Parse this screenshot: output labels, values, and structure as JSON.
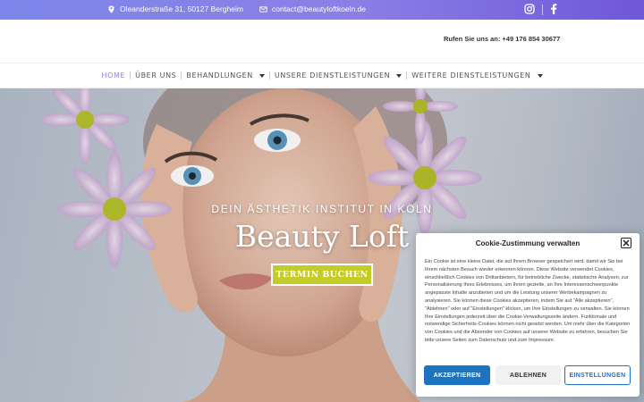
{
  "topbar": {
    "address": "Oleanderstraße 31, 50127 Bergheim",
    "email": "contact@beautyloftkoeln.de",
    "icons": [
      "map-pin-icon",
      "mail-icon",
      "instagram-icon",
      "facebook-icon"
    ]
  },
  "header": {
    "phone": "Rufen Sie uns an: +49 176 854 30677"
  },
  "nav": {
    "items": [
      {
        "label": "HOME",
        "active": true
      },
      {
        "label": "ÜBER UNS"
      },
      {
        "label": "BEHANDLUNGEN",
        "dropdown": true
      },
      {
        "label": "UNSERE DIENSTLEISTUNGEN",
        "dropdown": true
      },
      {
        "label": "WEITERE DIENSTLEISTUNGEN",
        "dropdown": true
      }
    ]
  },
  "hero": {
    "tagline": "DEIN ÄSTHETIK INSTITUT IN KÖLN",
    "title": "Beauty Loft",
    "cta": "TERMIN BUCHEN"
  },
  "cookie": {
    "title": "Cookie-Zustimmung verwalten",
    "body": "Ein Cookie ist eine kleine Datei, die auf Ihrem Browser gespeichert wird, damit wir Sie bei Ihrem nächsten Besuch wieder erkennen können. Diese Website verwendet Cookies, einschließlich Cookies von Drittanbietern, für betriebliche Zwecke, statistische Analysen, zur Personalisierung Ihres Erlebnisses, um Ihnen gezielte, an Ihre Interessenschwerpunkte angepasste Inhalte anzubieten und um die Leistung unserer Werbekampagnen zu analysieren. Sie können diese Cookies akzeptieren, indem Sie auf \"Alle akzeptieren\", \"Ablehnen\" oder auf \"Einstellungen\" klicken, um Ihre Einstellungen zu verwalten. Sie können Ihre Einstellungen jederzeit über die Cookie-Verwaltungsseite ändern. Funktionale und notwendige Sicherheits-Cookies können nicht gesetzt werden. Um mehr über die Kategorien von Cookies und die Absender von Cookies auf unserer Website zu erfahren, besuchen Sie bitte unsere Seiten zum Datenschutz und zum Impressum.",
    "accept": "AKZEPTIEREN",
    "decline": "ABLEHNEN",
    "settings": "EINSTELLUNGEN"
  },
  "colors": {
    "topbar_start": "#7d86ea",
    "topbar_end": "#6f57d8",
    "nav_active": "#8a7fe6",
    "cta": "#c4cc2a",
    "accept_button": "#1e73be"
  }
}
